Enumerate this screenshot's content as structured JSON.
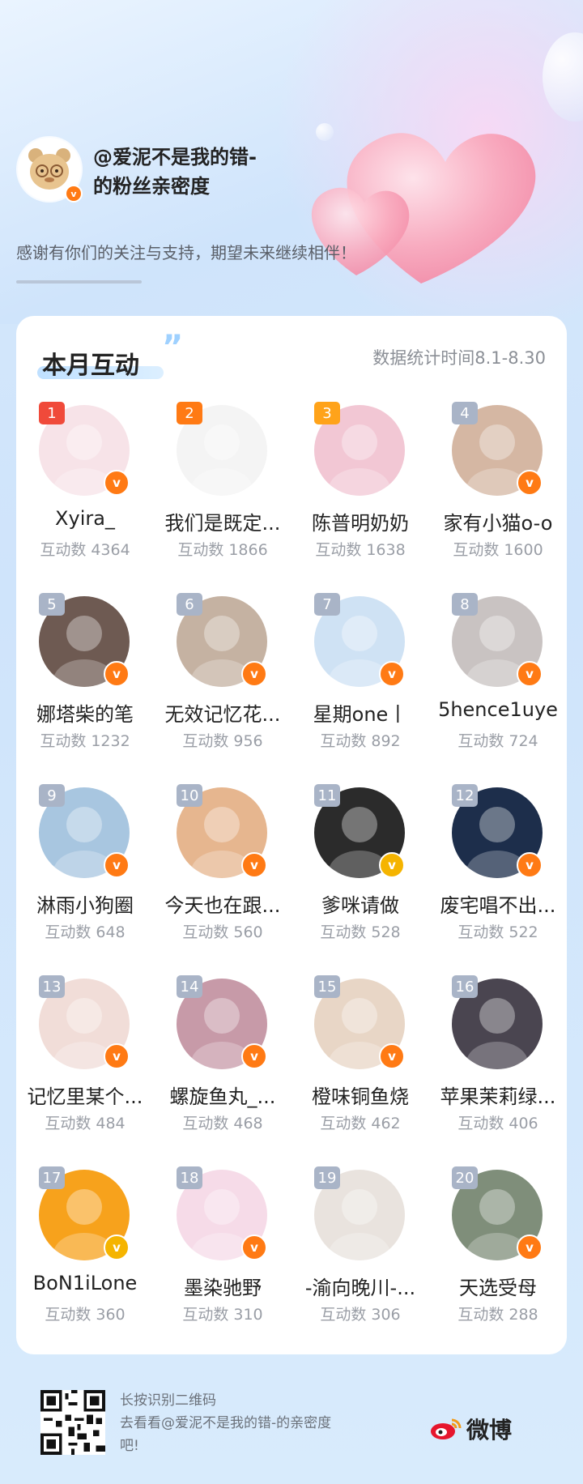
{
  "header": {
    "title_line1": "@爱泥不是我的错-",
    "title_line2": "的粉丝亲密度",
    "subtitle": "感谢有你们的关注与支持，期望未来继续相伴！"
  },
  "section": {
    "title": "本月互动",
    "stats_time": "数据统计时间8.1-8.30"
  },
  "count_label": "互动数",
  "fans": [
    {
      "rank": "1",
      "name": "Xyira_",
      "count": "4364",
      "rank_color": "#f04a3a",
      "avatar_color": "#f7e3e8",
      "badge": "orange"
    },
    {
      "rank": "2",
      "name": "我们是既定...",
      "count": "1866",
      "rank_color": "#ff7a14",
      "avatar_color": "#f4f4f4",
      "badge": "none"
    },
    {
      "rank": "3",
      "name": "陈普明奶奶",
      "count": "1638",
      "rank_color": "#ffa31a",
      "avatar_color": "#f2c7d4",
      "badge": "none"
    },
    {
      "rank": "4",
      "name": "家有小猫o-o",
      "count": "1600",
      "rank_color": "#a9b4c7",
      "avatar_color": "#d5b7a3",
      "badge": "orange"
    },
    {
      "rank": "5",
      "name": "娜塔柴的笔",
      "count": "1232",
      "rank_color": "#a9b4c7",
      "avatar_color": "#6e5a52",
      "badge": "orange"
    },
    {
      "rank": "6",
      "name": "无效记忆花...",
      "count": "956",
      "rank_color": "#a9b4c7",
      "avatar_color": "#c5b2a2",
      "badge": "orange"
    },
    {
      "rank": "7",
      "name": "星期one丨",
      "count": "892",
      "rank_color": "#a9b4c7",
      "avatar_color": "#cfe2f4",
      "badge": "orange"
    },
    {
      "rank": "8",
      "name": "5hence1uye",
      "count": "724",
      "rank_color": "#a9b4c7",
      "avatar_color": "#c9c3c2",
      "badge": "orange"
    },
    {
      "rank": "9",
      "name": "淋雨小狗圈",
      "count": "648",
      "rank_color": "#a9b4c7",
      "avatar_color": "#a8c6e0",
      "badge": "orange"
    },
    {
      "rank": "10",
      "name": "今天也在跟...",
      "count": "560",
      "rank_color": "#a9b4c7",
      "avatar_color": "#e6b68f",
      "badge": "orange"
    },
    {
      "rank": "11",
      "name": "爹咪请做",
      "count": "528",
      "rank_color": "#a9b4c7",
      "avatar_color": "#2b2b2b",
      "badge": "gold"
    },
    {
      "rank": "12",
      "name": "废宅唱不出...",
      "count": "522",
      "rank_color": "#a9b4c7",
      "avatar_color": "#1d2e4b",
      "badge": "orange"
    },
    {
      "rank": "13",
      "name": "记忆里某个...",
      "count": "484",
      "rank_color": "#a9b4c7",
      "avatar_color": "#f1ddd8",
      "badge": "orange"
    },
    {
      "rank": "14",
      "name": "螺旋鱼丸_...",
      "count": "468",
      "rank_color": "#a9b4c7",
      "avatar_color": "#c79aa8",
      "badge": "orange"
    },
    {
      "rank": "15",
      "name": "橙味铜鱼烧",
      "count": "462",
      "rank_color": "#a9b4c7",
      "avatar_color": "#e8d6c6",
      "badge": "orange"
    },
    {
      "rank": "16",
      "name": "苹果茉莉绿...",
      "count": "406",
      "rank_color": "#a9b4c7",
      "avatar_color": "#4a4550",
      "badge": "none"
    },
    {
      "rank": "17",
      "name": "BoN1iLone",
      "count": "360",
      "rank_color": "#a9b4c7",
      "avatar_color": "#f7a21c",
      "badge": "gold"
    },
    {
      "rank": "18",
      "name": "墨染驰野",
      "count": "310",
      "rank_color": "#a9b4c7",
      "avatar_color": "#f6dbe8",
      "badge": "orange"
    },
    {
      "rank": "19",
      "name": "-渝向晚川-...",
      "count": "306",
      "rank_color": "#a9b4c7",
      "avatar_color": "#e9e3de",
      "badge": "none"
    },
    {
      "rank": "20",
      "name": "天选受母",
      "count": "288",
      "rank_color": "#a9b4c7",
      "avatar_color": "#7f8e7a",
      "badge": "orange"
    }
  ],
  "footer": {
    "line1": "长按识别二维码",
    "line2": "去看看@爱泥不是我的错-的亲密度",
    "line3": "吧!",
    "brand": "微博"
  }
}
